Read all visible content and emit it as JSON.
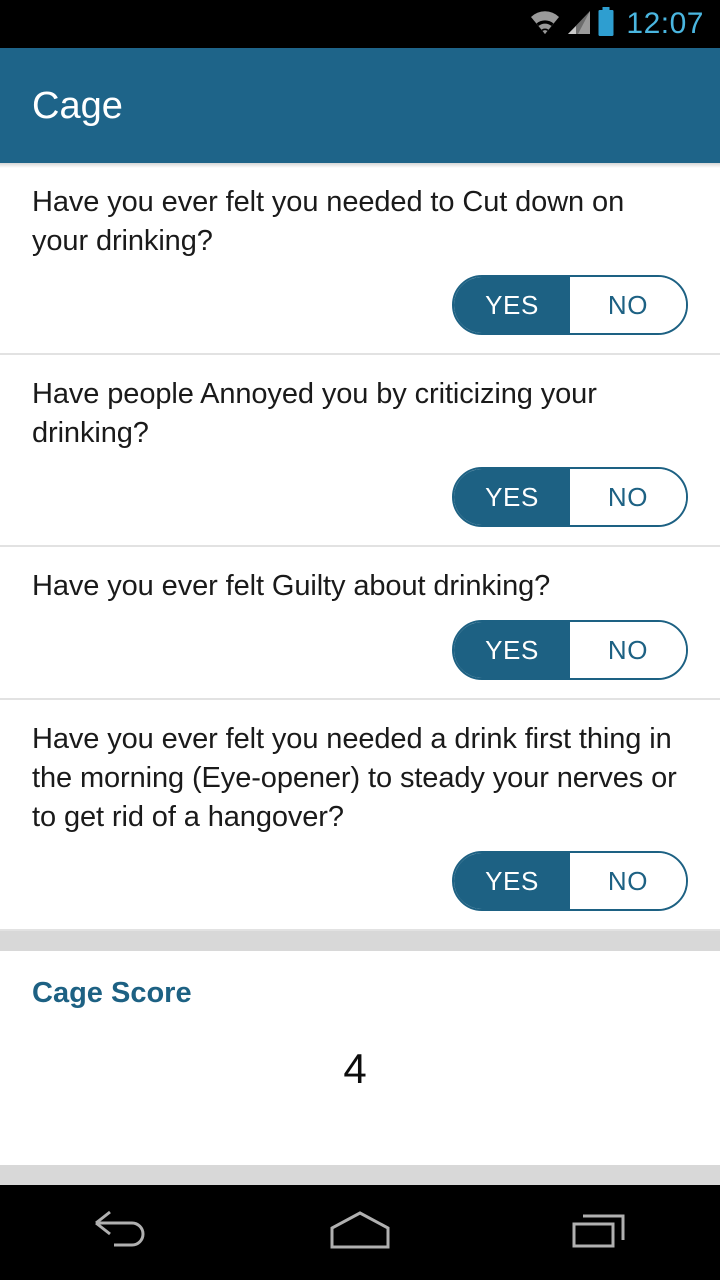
{
  "status_bar": {
    "time": "12:07",
    "icons": [
      "wifi-icon",
      "cellular-signal-icon",
      "battery-icon"
    ],
    "clock_color": "#4ab6e0"
  },
  "app_bar": {
    "title": "Cage",
    "background_color": "#1e6489",
    "title_color": "#ffffff"
  },
  "theme": {
    "accent": "#1d6183",
    "divider": "#e2e2e2",
    "band": "#d8d8d8"
  },
  "questions": [
    {
      "text": "Have you ever felt you needed to Cut down on your drinking?",
      "yes_label": "YES",
      "no_label": "NO",
      "selected": "YES"
    },
    {
      "text": "Have people Annoyed you by criticizing your drinking?",
      "yes_label": "YES",
      "no_label": "NO",
      "selected": "YES"
    },
    {
      "text": "Have you ever felt Guilty about drinking?",
      "yes_label": "YES",
      "no_label": "NO",
      "selected": "YES"
    },
    {
      "text": "Have you ever felt you needed a drink first thing in the morning (Eye-opener) to steady your nerves or to get rid of a hangover?",
      "yes_label": "YES",
      "no_label": "NO",
      "selected": "YES"
    }
  ],
  "score": {
    "label": "Cage Score",
    "value": "4"
  },
  "nav_bar": {
    "back": "back-icon",
    "home": "home-icon",
    "recents": "recents-icon"
  }
}
